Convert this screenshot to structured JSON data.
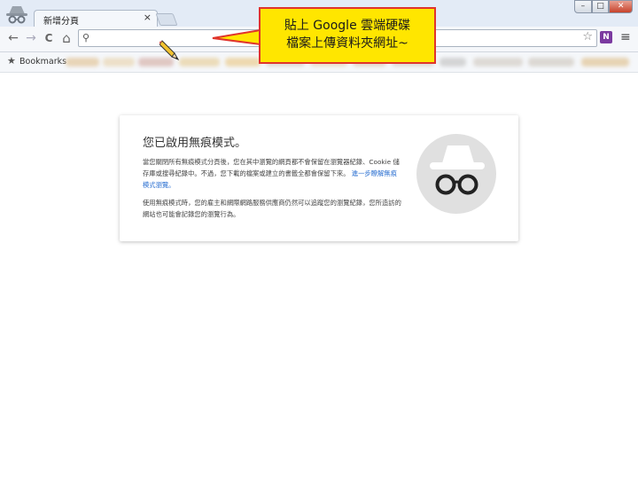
{
  "tab": {
    "title": "新增分頁",
    "close_glyph": "×"
  },
  "window_controls": {
    "minimize": "–",
    "maximize": "□",
    "close": "✕"
  },
  "toolbar": {
    "back_glyph": "←",
    "forward_glyph": "→",
    "reload_glyph": "C",
    "home_glyph": "⌂",
    "search_glyph": "⚲",
    "omnibox_value": "",
    "star_glyph": "☆",
    "onenote_label": "N",
    "menu_glyph": "≡"
  },
  "bookmarks": {
    "label": "Bookmarks",
    "star_glyph": "★"
  },
  "callout": {
    "line1": "貼上 Google 雲端硬碟",
    "line2": "檔案上傳資料夾網址~"
  },
  "incognito_card": {
    "title": "您已啟用無痕模式。",
    "paragraph1": "當您關閉所有無痕模式分頁後，您在其中瀏覽的網頁都不會保留在瀏覽器紀錄、Cookie 儲存庫或搜尋紀錄中。不過，您下載的檔案或建立的書籤全都會保留下來。",
    "learn_more": "進一步瞭解無痕模式瀏覽。",
    "paragraph2": "使用無痕模式時，您的雇主和網際網路服務供應商仍然可以追蹤您的瀏覽紀錄，您所造訪的網站也可能會記錄您的瀏覽行為。"
  },
  "colors": {
    "callout_fill": "#ffe600",
    "callout_border": "#e0342b",
    "link": "#2a6fd1"
  }
}
